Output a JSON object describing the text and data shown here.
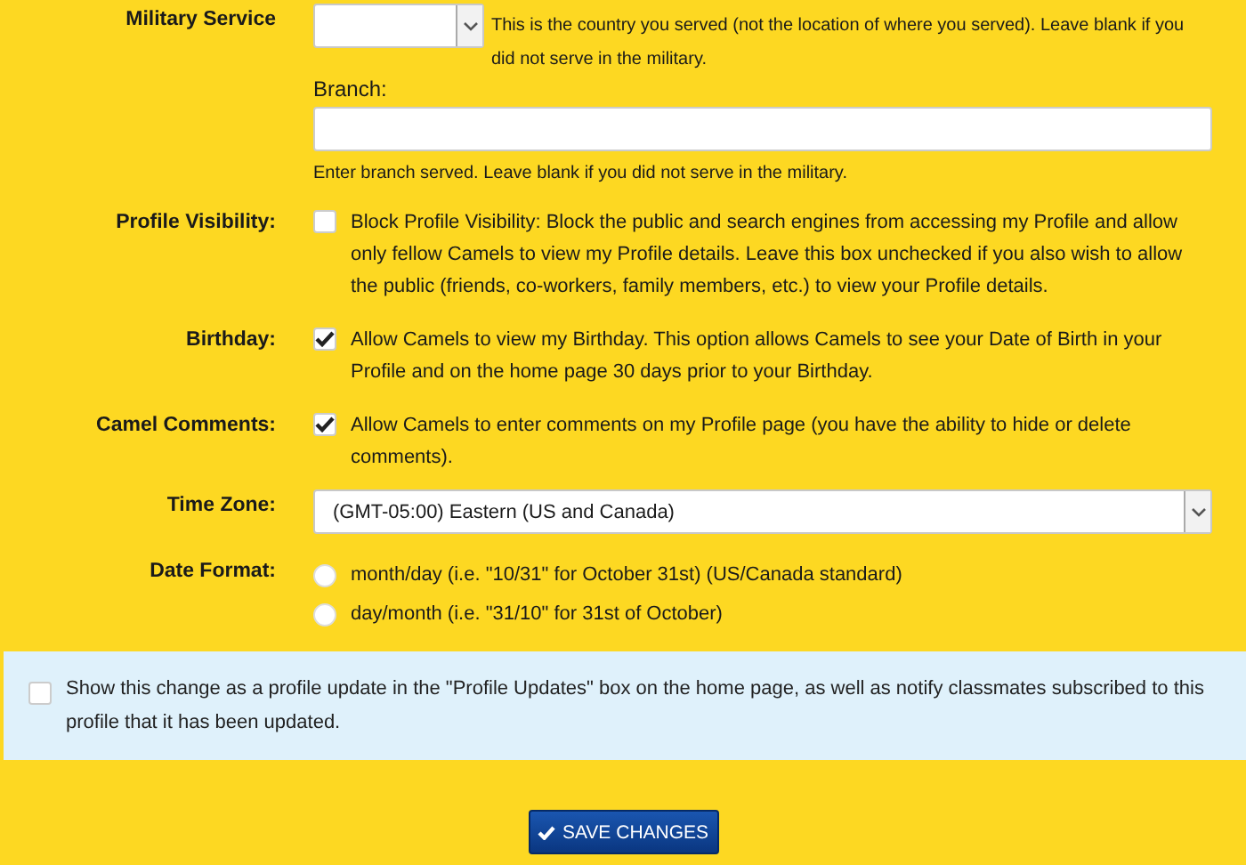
{
  "military_service": {
    "label": "Military Service",
    "country_hint": "This is the country you served (not the location of where you served). Leave blank if you did not serve in the military.",
    "branch_label": "Branch:",
    "branch_hint": "Enter branch served. Leave blank if you did not serve in the military."
  },
  "settings": [
    {
      "label": "Profile Visibility:",
      "checked": false,
      "text": "Block Profile Visibility: Block the public and search engines from accessing my Profile and allow only fellow Camels to view my Profile details. Leave this box unchecked if you also wish to allow the public (friends, co-workers, family members, etc.) to view your Profile details."
    },
    {
      "label": "Birthday:",
      "checked": true,
      "text": "Allow Camels to view my Birthday. This option allows Camels to see your Date of Birth in your Profile and on the home page 30 days prior to your Birthday."
    },
    {
      "label": "Camel Comments:",
      "checked": true,
      "text": "Allow Camels to enter comments on my Profile page (you have the ability to hide or delete comments)."
    }
  ],
  "time_zone": {
    "label": "Time Zone:",
    "value": "(GMT-05:00) Eastern (US and Canada)"
  },
  "date_format": {
    "label": "Date Format:",
    "options": [
      {
        "text": "month/day (i.e. \"10/31\" for October 31st) (US/Canada standard)",
        "selected": false
      },
      {
        "text": "day/month (i.e. \"31/10\" for 31st of October)",
        "selected": false
      }
    ]
  },
  "notify": {
    "checked": false,
    "text": "Show this change as a profile update in the \"Profile Updates\" box on the home page, as well as notify classmates subscribed to this profile that it has been updated."
  },
  "save_button": "SAVE CHANGES"
}
